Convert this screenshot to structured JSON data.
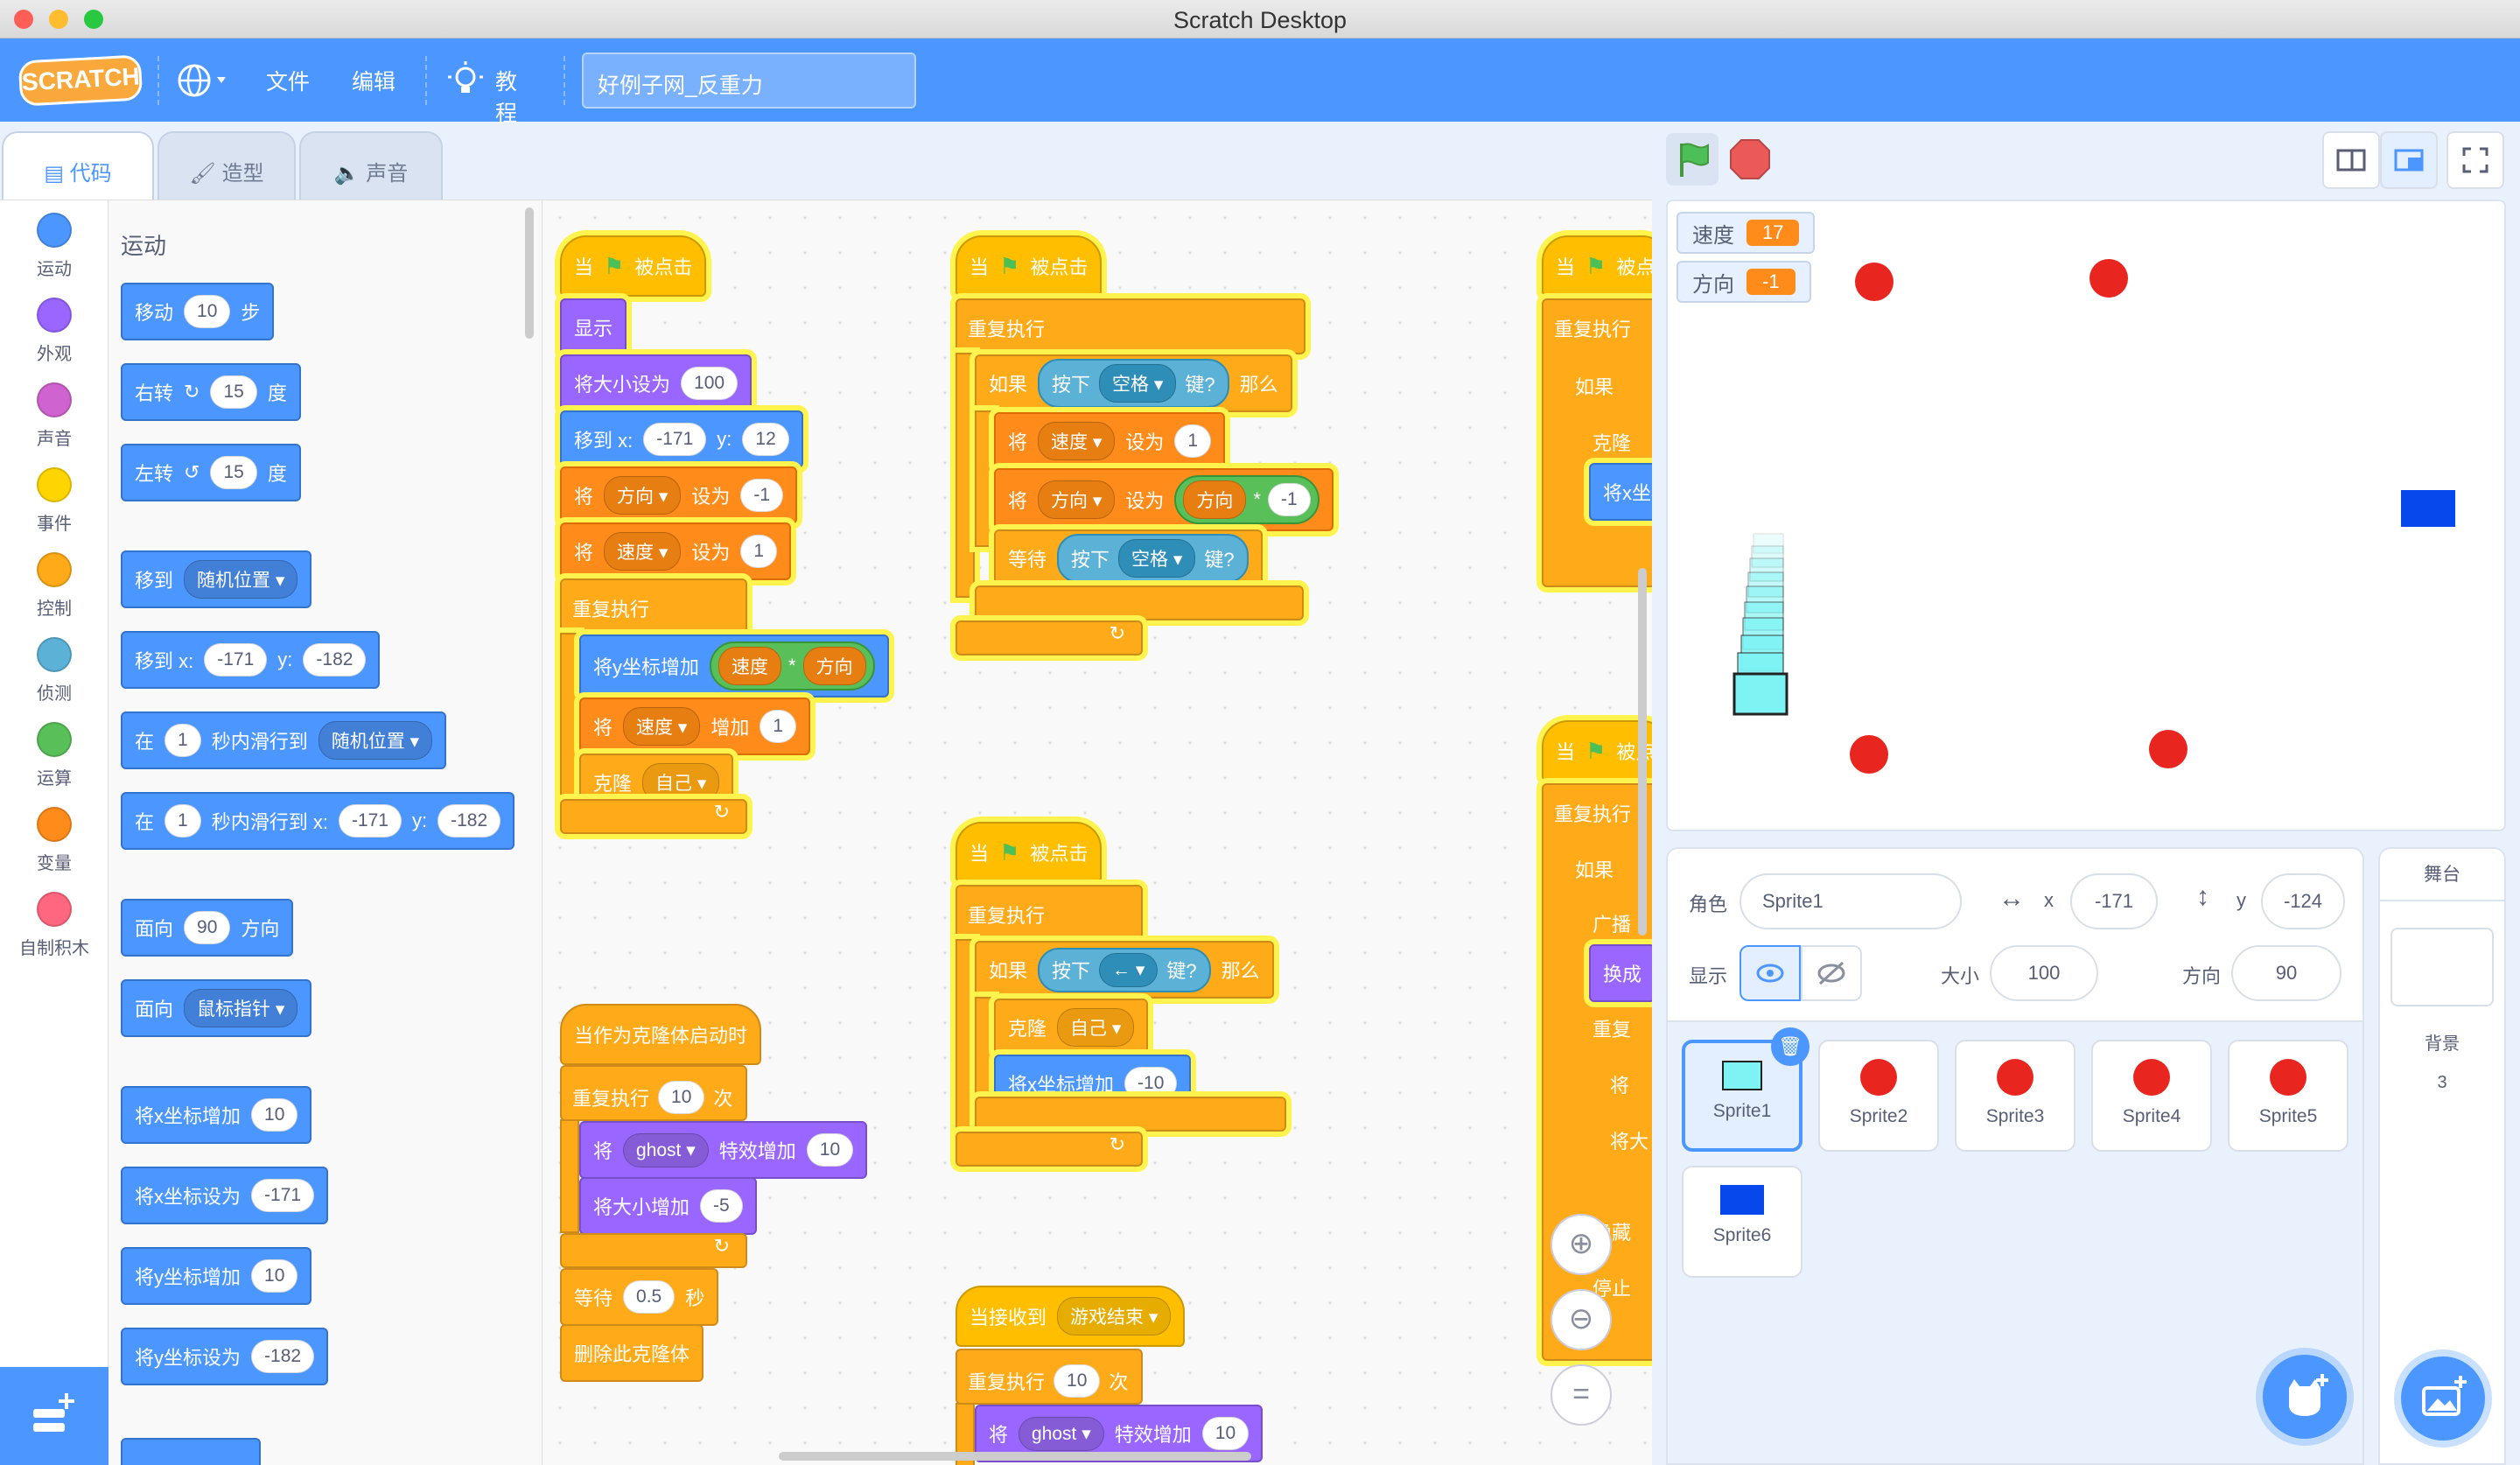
{
  "window": {
    "title": "Scratch Desktop"
  },
  "menu": {
    "logo": "SCRATCH",
    "file": "文件",
    "edit": "编辑",
    "tutorials": "教程",
    "project_title": "好例子网_反重力"
  },
  "tabs": {
    "code": "代码",
    "costumes": "造型",
    "sounds": "声音"
  },
  "categories": [
    {
      "label": "运动",
      "color": "#4c97ff"
    },
    {
      "label": "外观",
      "color": "#9966ff"
    },
    {
      "label": "声音",
      "color": "#cf63cf"
    },
    {
      "label": "事件",
      "color": "#ffd500"
    },
    {
      "label": "控制",
      "color": "#ffab19"
    },
    {
      "label": "侦测",
      "color": "#5cb1d6"
    },
    {
      "label": "运算",
      "color": "#59c059"
    },
    {
      "label": "变量",
      "color": "#ff8c1a"
    },
    {
      "label": "自制积木",
      "color": "#ff6680"
    }
  ],
  "palette": {
    "section": "运动",
    "move": {
      "a": "移动",
      "n": "10",
      "b": "步"
    },
    "turn_right": {
      "a": "右转",
      "n": "15",
      "b": "度"
    },
    "turn_left": {
      "a": "左转",
      "n": "15",
      "b": "度"
    },
    "goto": {
      "a": "移到",
      "dd": "随机位置"
    },
    "goto_xy": {
      "a": "移到 x:",
      "x": "-171",
      "yl": "y:",
      "y": "-182"
    },
    "glide": {
      "a": "在",
      "n": "1",
      "b": "秒内滑行到",
      "dd": "随机位置"
    },
    "glide_xy": {
      "a": "在",
      "n": "1",
      "b": "秒内滑行到 x:",
      "x": "-171",
      "yl": "y:",
      "y": "-182"
    },
    "point_dir": {
      "a": "面向",
      "n": "90",
      "b": "方向"
    },
    "point_towards": {
      "a": "面向",
      "dd": "鼠标指针"
    },
    "change_x": {
      "a": "将x坐标增加",
      "n": "10"
    },
    "set_x": {
      "a": "将x坐标设为",
      "n": "-171"
    },
    "change_y": {
      "a": "将y坐标增加",
      "n": "10"
    },
    "set_y": {
      "a": "将y坐标设为",
      "n": "-182"
    }
  },
  "scripts": {
    "when_flag_a": "当",
    "clicked": "被点击",
    "show": "显示",
    "set_size": {
      "a": "将大小设为",
      "n": "100"
    },
    "goto_xy": {
      "a": "移到 x:",
      "x": "-171",
      "yl": "y:",
      "y": "12"
    },
    "set_dir": {
      "a": "将",
      "var": "方向",
      "b": "设为",
      "n": "-1"
    },
    "set_speed": {
      "a": "将",
      "var": "速度",
      "b": "设为",
      "n": "1"
    },
    "forever": "重复执行",
    "change_y_op": {
      "a": "将y坐标增加",
      "v1": "速度",
      "op": "*",
      "v2": "方向"
    },
    "change_speed": {
      "a": "将",
      "var": "速度",
      "b": "增加",
      "n": "1"
    },
    "clone": {
      "a": "克隆",
      "dd": "自己"
    },
    "clone_start": "当作为克隆体启动时",
    "repeat10": {
      "a": "重复执行",
      "n": "10",
      "b": "次"
    },
    "ghost": {
      "a": "将",
      "dd": "ghost",
      "b": "特效增加",
      "n": "10"
    },
    "size_change": {
      "a": "将大小增加",
      "n": "-5"
    },
    "wait": {
      "a": "等待",
      "n": "0.5",
      "b": "秒"
    },
    "delete_clone": "删除此克隆体",
    "if": "如果",
    "then": "那么",
    "key_pressed": {
      "a": "按下",
      "space": "空格",
      "b": "键?",
      "left": "←"
    },
    "set_speed2": {
      "a": "将",
      "var": "速度",
      "b": "设为",
      "n": "1"
    },
    "set_dir_op": {
      "a": "将",
      "var": "方向",
      "b": "设为",
      "v": "方向",
      "op": "*",
      "n": "-1"
    },
    "wait_until": "等待",
    "change_x": {
      "a": "将x坐标增加",
      "n": "-10"
    },
    "when_receive": {
      "a": "当接收到",
      "dd": "游戏结束"
    },
    "partial": {
      "p1": "当",
      "p2": "被点",
      "p3": "如果",
      "p4": "克隆",
      "p5": "将x坐标",
      "p6": "广播",
      "p7": "换成",
      "p8": "重复",
      "p9": "将",
      "p10": "将大",
      "p11": "隐藏",
      "p12": "停止"
    }
  },
  "stage": {
    "monitors": [
      {
        "label": "速度",
        "value": "17"
      },
      {
        "label": "方向",
        "value": "-1"
      }
    ]
  },
  "sprite_info": {
    "sprite_label": "角色",
    "sprite_name": "Sprite1",
    "x_label": "x",
    "x": "-171",
    "y_label": "y",
    "y": "-124",
    "show_label": "显示",
    "size_label": "大小",
    "size": "100",
    "direction_label": "方向",
    "direction": "90"
  },
  "sprites": [
    {
      "name": "Sprite1",
      "kind": "cyan-square"
    },
    {
      "name": "Sprite2",
      "kind": "red-ball"
    },
    {
      "name": "Sprite3",
      "kind": "red-ball"
    },
    {
      "name": "Sprite4",
      "kind": "red-ball"
    },
    {
      "name": "Sprite5",
      "kind": "red-ball"
    },
    {
      "name": "Sprite6",
      "kind": "blue-square"
    }
  ],
  "stage_panel": {
    "title": "舞台",
    "backdrop_label": "背景",
    "backdrop_count": "3"
  },
  "colors": {
    "accent": "#4c97ff",
    "glow": "#fff34d"
  },
  "icons": [
    "globe-icon",
    "lightbulb-icon",
    "green-flag-icon",
    "stop-icon",
    "small-stage-icon",
    "large-stage-icon",
    "fullscreen-icon",
    "zoom-in-icon",
    "zoom-out-icon",
    "zoom-reset-icon",
    "eye-icon",
    "eye-slash-icon",
    "trash-icon",
    "add-sprite-icon",
    "add-backdrop-icon",
    "add-extension-icon"
  ]
}
